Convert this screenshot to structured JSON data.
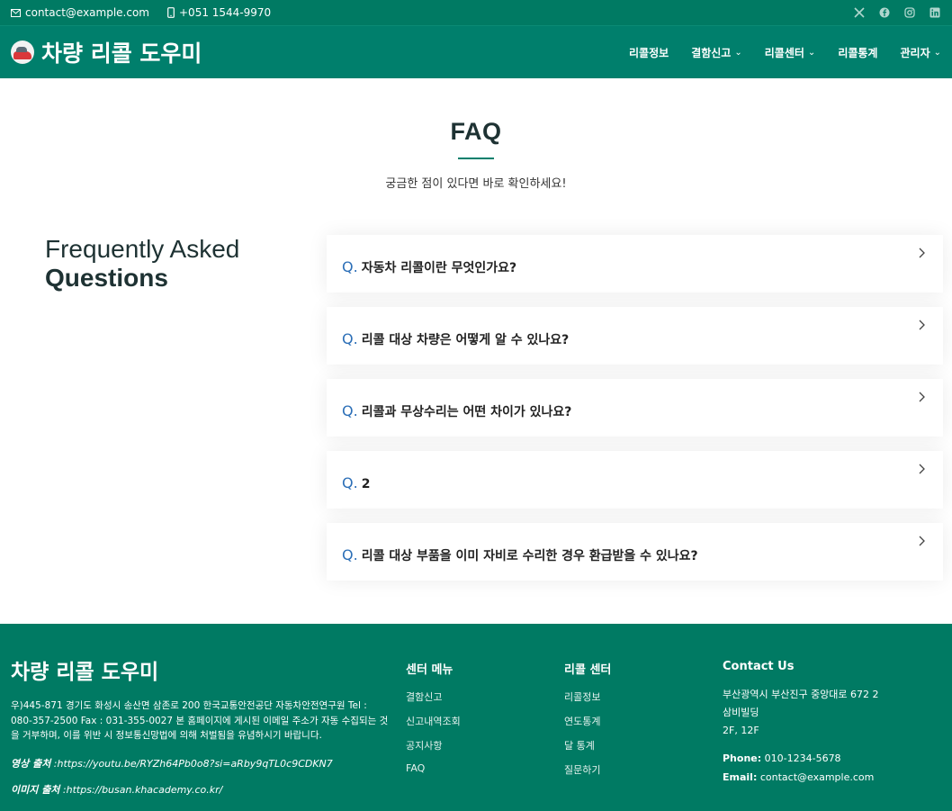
{
  "topbar": {
    "email": "contact@example.com",
    "phone": "+051 1544-9970",
    "socials": [
      "x-icon",
      "facebook-icon",
      "instagram-icon",
      "linkedin-icon"
    ]
  },
  "header": {
    "brand": "차량 리콜 도우미",
    "nav": [
      {
        "label": "리콜정보",
        "dropdown": false
      },
      {
        "label": "결함신고",
        "dropdown": true
      },
      {
        "label": "리콜센터",
        "dropdown": true
      },
      {
        "label": "리콜통계",
        "dropdown": false
      },
      {
        "label": "관리자",
        "dropdown": true
      }
    ]
  },
  "section": {
    "title": "FAQ",
    "subtitle": "궁금한 점이 있다면 바로 확인하세요!"
  },
  "faq": {
    "heading_light": "Frequently Asked",
    "heading_bold": "Questions",
    "items": [
      {
        "q": "Q.",
        "text": "자동차 리콜이란 무엇인가요?"
      },
      {
        "q": "Q.",
        "text": "리콜 대상 차량은 어떻게 알 수 있나요?"
      },
      {
        "q": "Q.",
        "text": "리콜과 무상수리는 어떤 차이가 있나요?"
      },
      {
        "q": "Q.",
        "text": "2"
      },
      {
        "q": "Q.",
        "text": "리콜 대상 부품을 이미 자비로 수리한 경우 환급받을 수 있나요?"
      }
    ]
  },
  "footer": {
    "title": "차량 리콜 도우미",
    "desc": "우)445-871 경기도 화성시 송산면 삼존로 200 한국교통안전공단 자동차안전연구원 Tel : 080-357-2500 Fax : 031-355-0027 본 홈페이지에 게시된 이메일 주소가 자동 수집되는 것을 거부하며, 이를 위반 시 정보통신망법에 의해 처벌됨을 유념하시기 바랍니다.",
    "src1_label": "영상 출처",
    "src1_value": " :https://youtu.be/RYZh64Pb0o8?si=aRby9qTL0c9CDKN7",
    "src2_label": "이미지 출처",
    "src2_value": " :https://busan.khacademy.co.kr/",
    "col1": {
      "title": "센터 메뉴",
      "links": [
        "결함신고",
        "신고내역조회",
        "공지사항",
        "FAQ"
      ]
    },
    "col2": {
      "title": "리콜 센터",
      "links": [
        "리콜정보",
        "연도통계",
        "달 통계",
        "질문하기"
      ]
    },
    "col3": {
      "title": "Contact Us",
      "addr1": "부산광역시 부산진구 중앙대로 672 2",
      "addr2": "삼비빌딩",
      "addr3": "2F, 12F",
      "phone_label": "Phone:",
      "phone": " 010-1234-5678",
      "email_label": "Email:",
      "email": " contact@example.com"
    }
  }
}
